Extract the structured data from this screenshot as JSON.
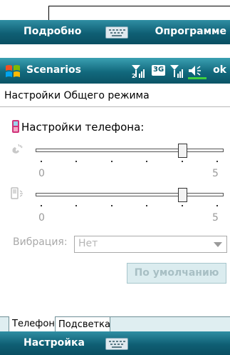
{
  "top_softkeys": {
    "left": "Подробно",
    "right": "Опрограмме"
  },
  "titlebar": {
    "title": "Scenarios",
    "status_3g": "3G",
    "ok_label": "ok",
    "signal_sub": "2"
  },
  "section_title": "Настройки Общего режима",
  "phone_settings_label": "Настройки телефона:",
  "sliders": [
    {
      "name": "ringer",
      "min_label": "0",
      "max_label": "5",
      "value": 4
    },
    {
      "name": "notification",
      "min_label": "0",
      "max_label": "5",
      "value": 4
    }
  ],
  "vibration": {
    "label": "Вибрация:",
    "selected": "Нет"
  },
  "default_button": "По умолчанию",
  "tabs": [
    {
      "label": "Телефон"
    },
    {
      "label": "Подсветка"
    }
  ],
  "bottom_softkeys": {
    "left": "Настройка"
  },
  "colors": {
    "bar": "#0f5f74",
    "bar_light": "#2f8ea3",
    "disabled": "#a9a9a9"
  }
}
